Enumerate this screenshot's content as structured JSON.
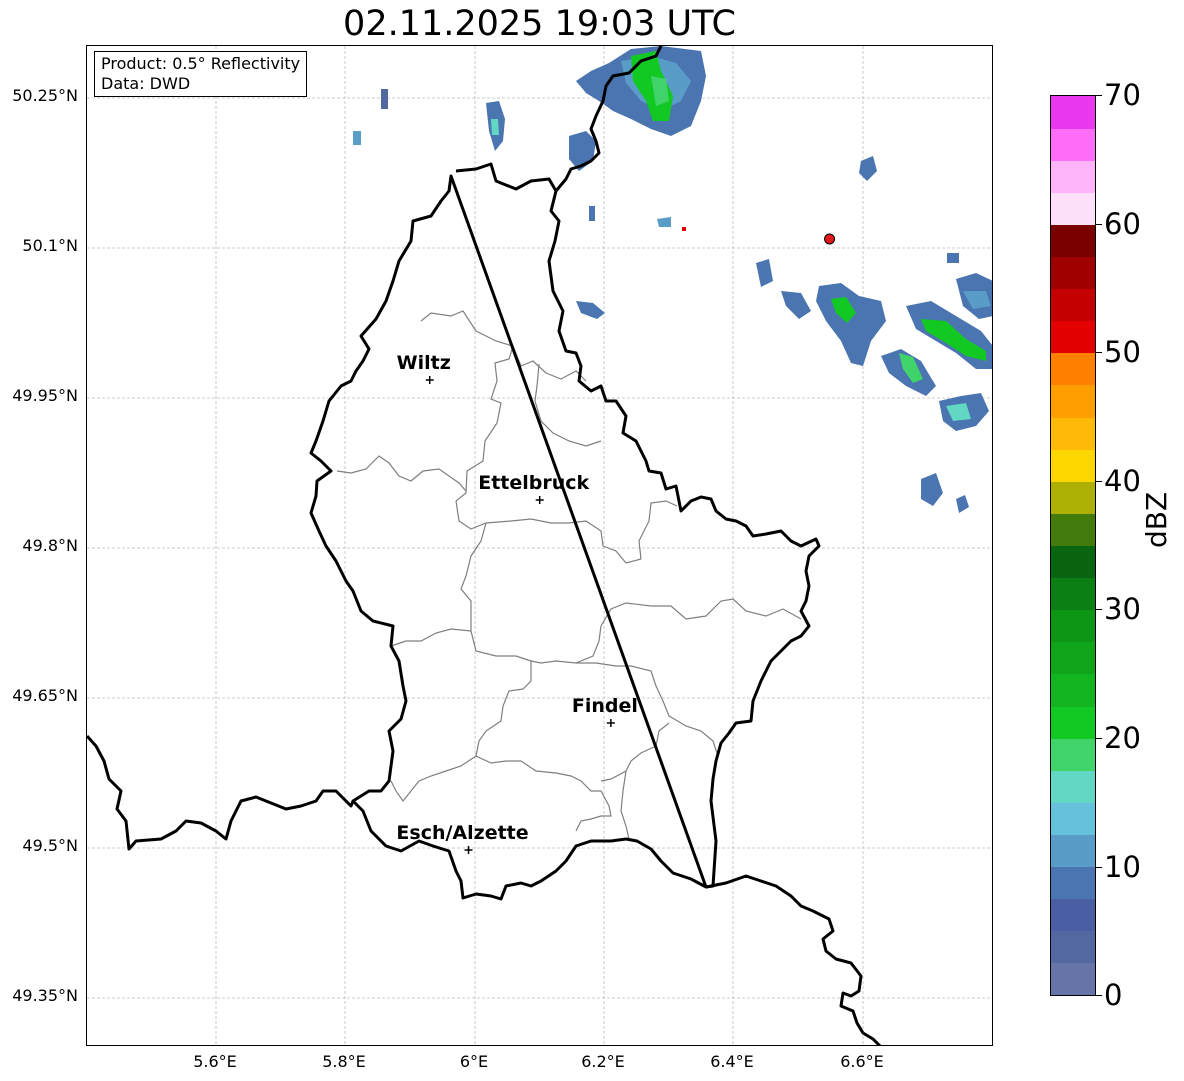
{
  "title": "02.11.2025 19:03 UTC",
  "info": {
    "product": "Product: 0.5° Reflectivity",
    "data": "Data: DWD"
  },
  "y_ticks": [
    "50.25°N",
    "50.1°N",
    "49.95°N",
    "49.8°N",
    "49.65°N",
    "49.5°N",
    "49.35°N"
  ],
  "x_ticks": [
    "5.6°E",
    "5.8°E",
    "6°E",
    "6.2°E",
    "6.4°E",
    "6.6°E"
  ],
  "cities": [
    {
      "name": "Wiltz",
      "lon": 5.93,
      "lat": 49.968
    },
    {
      "name": "Ettelbruck",
      "lon": 6.1,
      "lat": 49.848
    },
    {
      "name": "Findel",
      "lon": 6.21,
      "lat": 49.625
    },
    {
      "name": "Esch/Alzette",
      "lon": 5.99,
      "lat": 49.498
    }
  ],
  "radar_marker": {
    "lon": 6.548,
    "lat": 50.109,
    "color": "#e31a1c"
  },
  "colorbar": {
    "label": "dBZ",
    "ticks": [
      "0",
      "10",
      "20",
      "30",
      "40",
      "50",
      "60",
      "70"
    ],
    "colors": [
      "#6674a8",
      "#5368a0",
      "#4a5ea3",
      "#4a75b0",
      "#5a9cc8",
      "#66c2dc",
      "#62d8c4",
      "#3fd36a",
      "#12c823",
      "#12b51f",
      "#0fa41a",
      "#0d9516",
      "#0b7f13",
      "#0a6510",
      "#427a0c",
      "#adaf05",
      "#ffd700",
      "#ffb907",
      "#ff9e00",
      "#ff7f00",
      "#e30000",
      "#c40000",
      "#a10000",
      "#7a0000",
      "#ffe0fb",
      "#ffb4f9",
      "#ff6cf8",
      "#e938f0"
    ]
  }
}
